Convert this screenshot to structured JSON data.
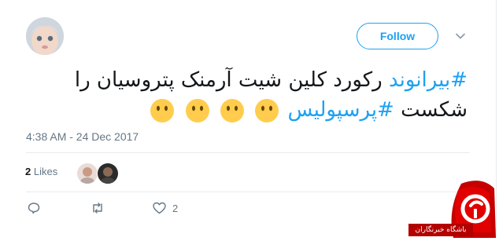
{
  "tweet": {
    "follow_label": "Follow",
    "text_line1": "#بیرانوند رکورد کلین شیت آرمنک پتروسیان را",
    "text_line2_hashtag": "#پرسپولیس",
    "text_line2_rest": "شکست ",
    "emoji": [
      "smiling-face-emoji",
      "smiling-face-emoji",
      "smiling-face-emoji",
      "smiling-face-emoji"
    ],
    "timestamp": "4:38 AM - 24 Dec 2017",
    "likes": {
      "count": "2",
      "label": "Likes"
    },
    "actions": {
      "reply_count": "",
      "retweet_count": "",
      "like_count": "2"
    }
  },
  "watermark": {
    "text": "باشگاه خبرنگاران"
  },
  "colors": {
    "accent": "#1da1f2",
    "text": "#14171a",
    "muted": "#657786",
    "divider": "#e6ecf0",
    "watermark": "#b30000"
  }
}
